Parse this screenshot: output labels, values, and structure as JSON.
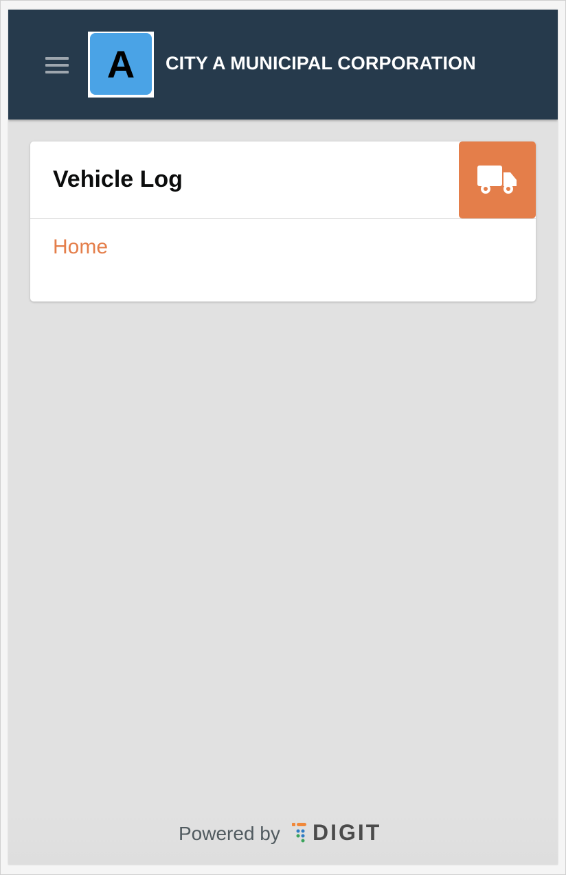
{
  "header": {
    "logo_letter": "A",
    "title": "CITY A MUNICIPAL CORPORATION",
    "menu_icon": "hamburger-menu-icon",
    "background_color": "#263a4c"
  },
  "card": {
    "title": "Vehicle Log",
    "icon": "truck-icon",
    "icon_background_color": "#e47e4a",
    "links": [
      {
        "label": "Home"
      }
    ]
  },
  "footer": {
    "powered_by": "Powered by",
    "brand": "DIGIT"
  },
  "colors": {
    "accent": "#e47e4a",
    "page_background": "#e1e1e1",
    "header": "#263a4c"
  }
}
